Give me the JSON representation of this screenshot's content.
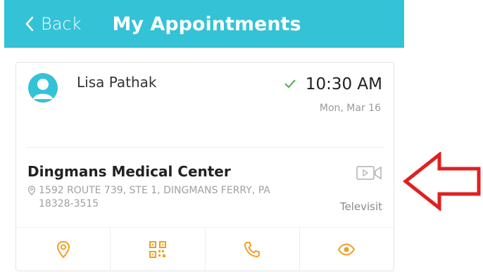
{
  "header": {
    "back_label": "Back",
    "title": "My Appointments"
  },
  "appointment": {
    "patient_name": "Lisa Pathak",
    "time": "10:30 AM",
    "date": "Mon, Mar 16",
    "confirmed": true,
    "clinic_name": "Dingmans Medical Center",
    "address": "1592 ROUTE 739, STE 1, DINGMANS FERRY, PA 18328-3515",
    "visit_type": "Televisit"
  },
  "actions": [
    {
      "name": "location-action",
      "icon": "map-pin-icon"
    },
    {
      "name": "qr-code-action",
      "icon": "qr-code-icon"
    },
    {
      "name": "call-action",
      "icon": "phone-icon"
    },
    {
      "name": "view-action",
      "icon": "eye-icon"
    }
  ],
  "colors": {
    "header": "#33c2d6",
    "avatar": "#33c2d6",
    "action_icon": "#f0a020",
    "check": "#4caf50",
    "annotation_arrow": "#e02020"
  }
}
